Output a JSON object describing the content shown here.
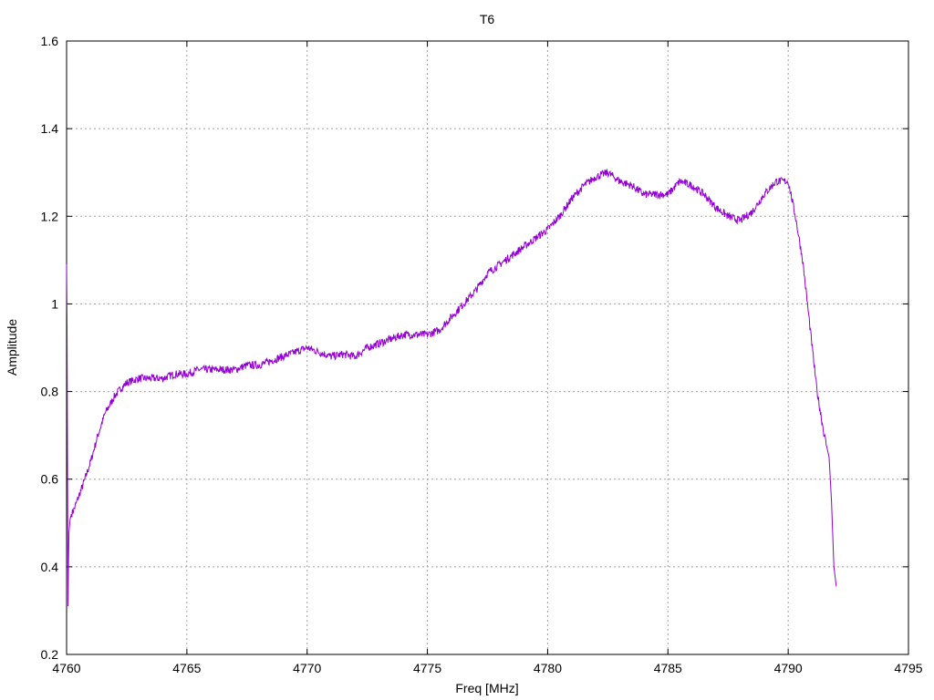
{
  "chart_data": {
    "type": "line",
    "title": "T6",
    "xlabel": "Freq [MHz]",
    "ylabel": "Amplitude",
    "xlim": [
      4760,
      4795
    ],
    "ylim": [
      0.2,
      1.6
    ],
    "xticks": [
      4760,
      4765,
      4770,
      4775,
      4780,
      4785,
      4790,
      4795
    ],
    "xtick_labels": [
      "4760",
      "4765",
      "4770",
      "4775",
      "4780",
      "4785",
      "4790",
      "4795"
    ],
    "yticks": [
      0.2,
      0.4,
      0.6,
      0.8,
      1.0,
      1.2,
      1.4,
      1.6
    ],
    "ytick_labels": [
      "0.2",
      "0.4",
      "0.6",
      "0.8",
      "1",
      "1.2",
      "1.4",
      "1.6"
    ],
    "grid": true,
    "legend": "none",
    "series": [
      {
        "color": "#9400d3",
        "x": [
          4760.0,
          4760.02,
          4760.04,
          4760.06,
          4760.08,
          4760.1,
          4760.15,
          4760.2,
          4760.3,
          4760.5,
          4760.7,
          4761.0,
          4761.3,
          4761.6,
          4762.0,
          4762.3,
          4762.5,
          4763.0,
          4763.5,
          4764.0,
          4764.5,
          4765.0,
          4765.5,
          4766.0,
          4766.5,
          4767.0,
          4767.5,
          4768.0,
          4768.5,
          4769.0,
          4769.5,
          4770.0,
          4770.5,
          4771.0,
          4771.5,
          4772.0,
          4772.5,
          4773.0,
          4773.5,
          4774.0,
          4774.5,
          4775.0,
          4775.5,
          4776.0,
          4776.5,
          4777.0,
          4777.5,
          4778.0,
          4778.5,
          4779.0,
          4779.5,
          4780.0,
          4780.5,
          4781.0,
          4781.5,
          4782.0,
          4782.5,
          4783.0,
          4783.5,
          4784.0,
          4784.5,
          4785.0,
          4785.5,
          4786.0,
          4786.5,
          4787.0,
          4787.5,
          4788.0,
          4788.5,
          4789.0,
          4789.5,
          4790.0,
          4790.3,
          4790.6,
          4790.9,
          4791.2,
          4791.5,
          4791.7,
          4791.8,
          4791.9,
          4792.0
        ],
        "y": [
          1.09,
          0.95,
          0.6,
          0.31,
          0.42,
          0.48,
          0.51,
          0.52,
          0.53,
          0.56,
          0.59,
          0.64,
          0.7,
          0.75,
          0.79,
          0.81,
          0.82,
          0.83,
          0.83,
          0.83,
          0.84,
          0.84,
          0.85,
          0.85,
          0.85,
          0.85,
          0.86,
          0.86,
          0.87,
          0.88,
          0.89,
          0.9,
          0.89,
          0.88,
          0.885,
          0.88,
          0.9,
          0.91,
          0.92,
          0.93,
          0.93,
          0.93,
          0.94,
          0.97,
          1.0,
          1.03,
          1.07,
          1.09,
          1.11,
          1.13,
          1.15,
          1.17,
          1.2,
          1.24,
          1.27,
          1.29,
          1.3,
          1.28,
          1.27,
          1.25,
          1.25,
          1.25,
          1.28,
          1.27,
          1.25,
          1.22,
          1.2,
          1.19,
          1.21,
          1.25,
          1.28,
          1.28,
          1.2,
          1.1,
          0.95,
          0.8,
          0.7,
          0.65,
          0.55,
          0.4,
          0.355
        ]
      }
    ]
  }
}
